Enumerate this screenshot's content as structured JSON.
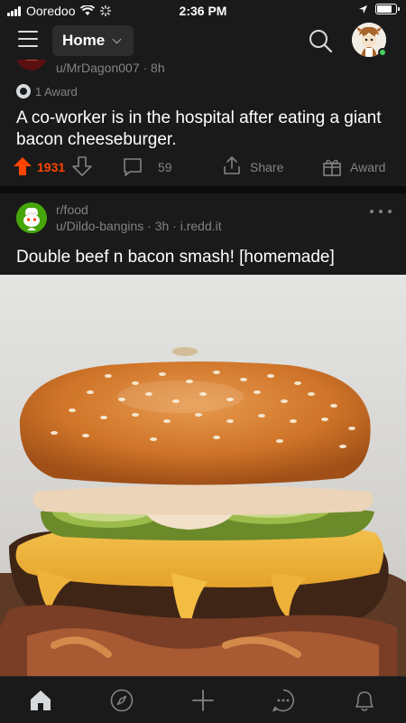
{
  "status_bar": {
    "carrier": "Ooredoo",
    "time": "2:36 PM"
  },
  "header": {
    "feed_label": "Home",
    "icons": [
      "menu-icon",
      "chevron-down-icon",
      "search-icon",
      "avatar"
    ]
  },
  "post1": {
    "author": "u/MrDagon007 · 8h",
    "award": "1 Award",
    "title": "A co-worker is in the hospital after eating a giant bacon cheeseburger.",
    "votes": "1931",
    "comments": "59",
    "share_label": "Share",
    "award_label": "Award"
  },
  "post2": {
    "subreddit": "r/food",
    "meta": "u/Dildo-bangins · 3h · i.redd.it",
    "title": "Double beef n bacon smash! [homemade]"
  },
  "tabbar": {
    "items": [
      "home-icon",
      "compass-icon",
      "plus-icon",
      "chat-icon",
      "bell-icon"
    ]
  },
  "colors": {
    "background": "#1a1a1b",
    "upvote": "#ff4500",
    "online": "#46d160",
    "muted": "#818384"
  }
}
